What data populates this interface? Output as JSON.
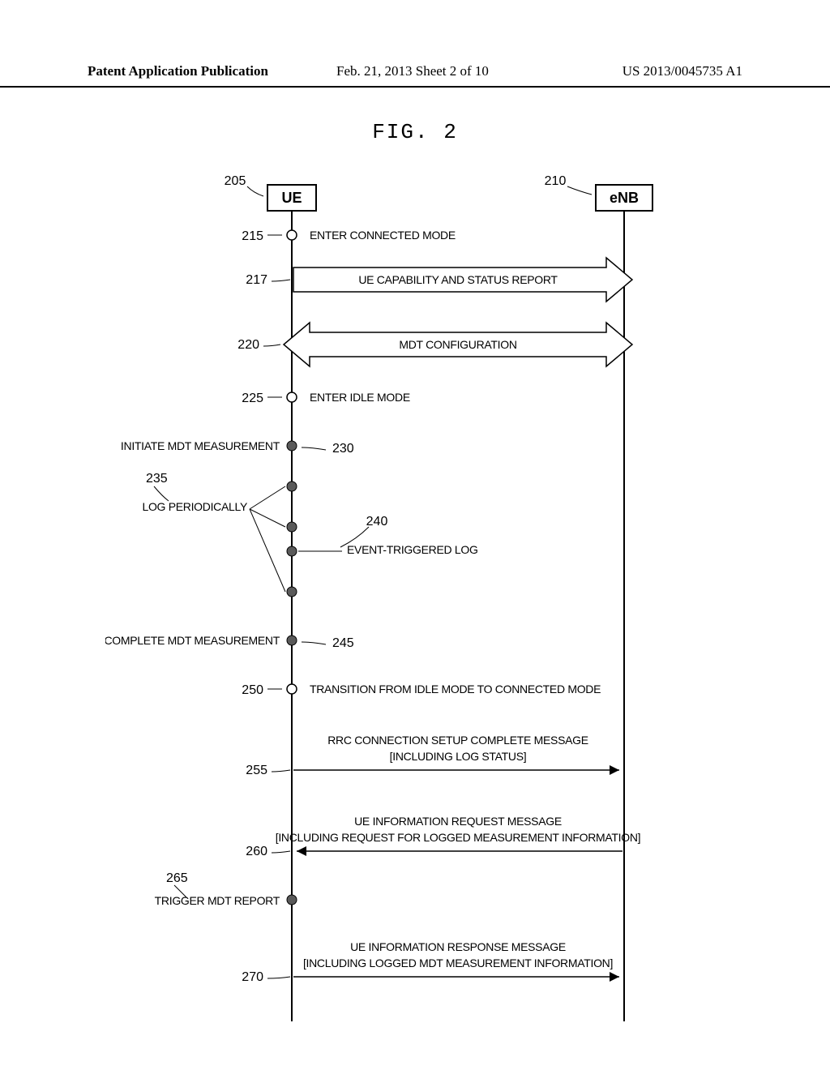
{
  "header": {
    "left": "Patent Application Publication",
    "middle": "Feb. 21, 2013  Sheet 2 of 10",
    "right": "US 2013/0045735 A1"
  },
  "figure_title": "FIG. 2",
  "actors": {
    "ue": {
      "ref": "205",
      "label": "UE"
    },
    "enb": {
      "ref": "210",
      "label": "eNB"
    }
  },
  "events": [
    {
      "ref": "215",
      "text": "ENTER CONNECTED MODE"
    },
    {
      "ref": "217",
      "text": "UE CAPABILITY AND STATUS REPORT"
    },
    {
      "ref": "220",
      "text": "MDT CONFIGURATION"
    },
    {
      "ref": "225",
      "text": "ENTER IDLE MODE"
    },
    {
      "ref": "230",
      "text": "INITIATE MDT MEASUREMENT"
    },
    {
      "ref": "235",
      "text": "LOG PERIODICALLY"
    },
    {
      "ref": "240",
      "text": "EVENT-TRIGGERED LOG"
    },
    {
      "ref": "245",
      "text": "COMPLETE MDT MEASUREMENT"
    },
    {
      "ref": "250",
      "text": "TRANSITION FROM IDLE MODE TO CONNECTED MODE"
    },
    {
      "ref": "255",
      "line1": "RRC CONNECTION SETUP COMPLETE MESSAGE",
      "line2": "[INCLUDING LOG STATUS]"
    },
    {
      "ref": "260",
      "line1": "UE INFORMATION REQUEST MESSAGE",
      "line2": "[INCLUDING REQUEST FOR LOGGED MEASUREMENT INFORMATION]"
    },
    {
      "ref": "265",
      "text": "TRIGGER MDT REPORT"
    },
    {
      "ref": "270",
      "line1": "UE INFORMATION RESPONSE MESSAGE",
      "line2": "[INCLUDING LOGGED MDT MEASUREMENT INFORMATION]"
    }
  ]
}
